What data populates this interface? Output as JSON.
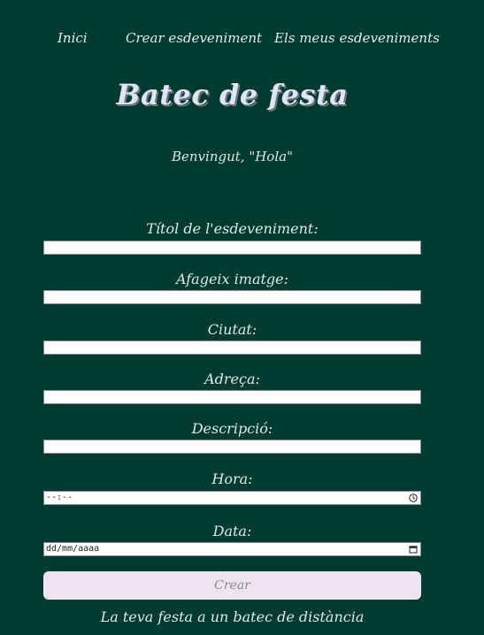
{
  "nav": {
    "items": [
      "Inici",
      "Crear esdeveniment",
      "Els meus esdeveniments"
    ]
  },
  "header": {
    "title": "Batec de festa",
    "welcome": "Benvingut, \"Hola\""
  },
  "form": {
    "title_label": "Títol de l'esdeveniment:",
    "image_label": "Afageix imatge:",
    "city_label": "Ciutat:",
    "address_label": "Adreça:",
    "description_label": "Descripció:",
    "time_label": "Hora:",
    "time_placeholder": "--:--",
    "date_label": "Data:",
    "date_placeholder": "dd/mm/aaaa",
    "submit_label": "Crear"
  },
  "footer": {
    "tagline": "La teva festa a un batec de distància"
  },
  "colors": {
    "background": "#003b33",
    "text": "#dde9f0",
    "button_bg": "#ede4ef",
    "button_text": "#8a8795"
  }
}
